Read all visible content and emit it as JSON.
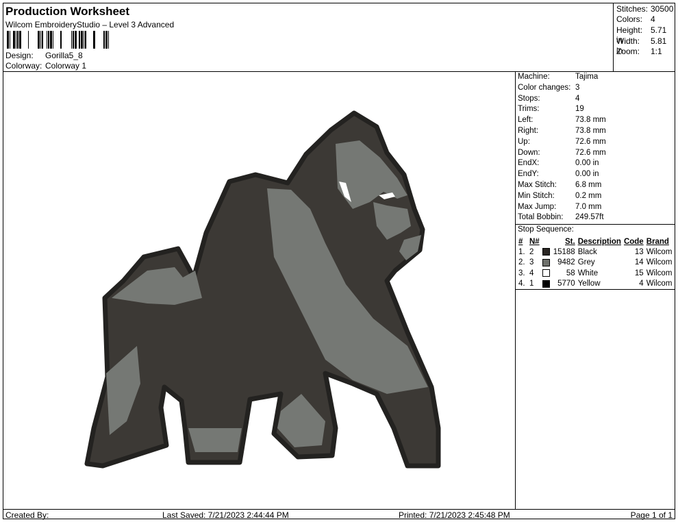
{
  "header": {
    "title": "Production Worksheet",
    "software": "Wilcom EmbroideryStudio – Level 3 Advanced",
    "design_label": "Design:",
    "design_value": "Gorilla5_8",
    "colorway_label": "Colorway:",
    "colorway_value": "Colorway 1"
  },
  "stats": [
    {
      "label": "Stitches:",
      "value": "30500"
    },
    {
      "label": "Colors:",
      "value": "4"
    },
    {
      "label": "Height:",
      "value": "5.71 in"
    },
    {
      "label": "Width:",
      "value": "5.81 in"
    },
    {
      "label": "Zoom:",
      "value": "1:1"
    }
  ],
  "machine_info": [
    {
      "label": "Machine:",
      "value": "Tajima"
    },
    {
      "label": "Color changes:",
      "value": "3"
    },
    {
      "label": "Stops:",
      "value": "4"
    },
    {
      "label": "Trims:",
      "value": "19"
    },
    {
      "label": "Left:",
      "value": "73.8 mm"
    },
    {
      "label": "Right:",
      "value": "73.8 mm"
    },
    {
      "label": "Up:",
      "value": "72.6 mm"
    },
    {
      "label": "Down:",
      "value": "72.6 mm"
    },
    {
      "label": "EndX:",
      "value": "0.00 in"
    },
    {
      "label": "EndY:",
      "value": "0.00 in"
    },
    {
      "label": "Max Stitch:",
      "value": "6.8 mm"
    },
    {
      "label": "Min Stitch:",
      "value": "0.2 mm"
    },
    {
      "label": "Max Jump:",
      "value": "7.0 mm"
    },
    {
      "label": "Total Bobbin:",
      "value": "249.57ft"
    }
  ],
  "stop_sequence": {
    "title": "Stop Sequence:",
    "headers": {
      "num": "#",
      "n": "N#",
      "st": "St.",
      "desc": "Description",
      "code": "Code",
      "brand": "Brand"
    },
    "rows": [
      {
        "num": "1.",
        "n": "2",
        "color": "#2a2623",
        "st": "15188",
        "desc": "Black",
        "code": "13",
        "brand": "Wilcom"
      },
      {
        "num": "2.",
        "n": "3",
        "color": "#6f716c",
        "st": "9482",
        "desc": "Grey",
        "code": "14",
        "brand": "Wilcom"
      },
      {
        "num": "3.",
        "n": "4",
        "color": "#ffffff",
        "st": "58",
        "desc": "White",
        "code": "15",
        "brand": "Wilcom"
      },
      {
        "num": "4.",
        "n": "1",
        "color": "#000000",
        "st": "5770",
        "desc": "Yellow",
        "code": "4",
        "brand": "Wilcom"
      }
    ]
  },
  "footer": {
    "created": "Created By:",
    "last_saved": "Last Saved: 7/21/2023 2:44:44 PM",
    "printed": "Printed: 7/21/2023 2:45:48 PM",
    "page": "Page 1 of 1"
  },
  "design_colors": {
    "outline": "#232220",
    "dark": "#3c3935",
    "grey": "#757874",
    "highlight": "#ffffff"
  }
}
